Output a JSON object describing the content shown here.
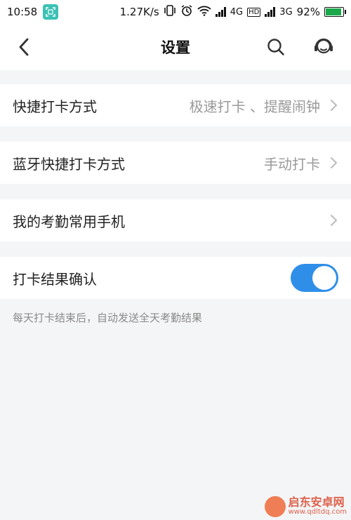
{
  "status_bar": {
    "time": "10:58",
    "speed": "1.27K/s",
    "net1": "4G",
    "hd": "HD",
    "net2": "3G",
    "battery_pct": "92%",
    "battery_level": 0.92,
    "icons": [
      "scan-icon",
      "vibrate-icon",
      "alarm-icon",
      "wifi-icon",
      "signal-icon",
      "battery-icon"
    ]
  },
  "nav": {
    "title": "设置",
    "icons": [
      "back-chevron-icon",
      "search-icon",
      "customer-service-icon"
    ]
  },
  "settings": {
    "quick_punch": {
      "label": "快捷打卡方式",
      "value": "极速打卡 、提醒闹钟"
    },
    "bluetooth_punch": {
      "label": "蓝牙快捷打卡方式",
      "value": "手动打卡"
    },
    "common_phone": {
      "label": "我的考勤常用手机"
    },
    "result_confirm": {
      "label": "打卡结果确认",
      "enabled": true
    }
  },
  "hint": "每天打卡结束后，自动发送全天考勤结果",
  "watermark": {
    "main": "启东安卓网",
    "sub": "www.qdltdq.com"
  },
  "colors": {
    "accent": "#2f8fe8",
    "background": "#f4f5f7",
    "secondary_text": "#9a9a9a"
  }
}
